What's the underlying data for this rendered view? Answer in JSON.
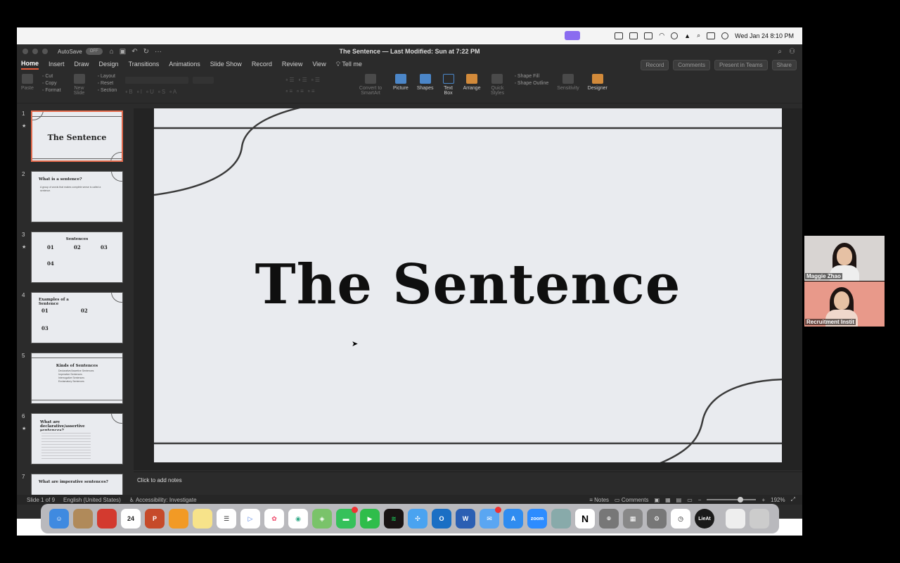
{
  "menubar": {
    "datetime": "Wed Jan 24  8:10 PM",
    "apple_icon": "apple-icon"
  },
  "window": {
    "autosave_label": "AutoSave",
    "autosave_state": "OFF",
    "title": "The Sentence — Last Modified: Sun at 7:22 PM"
  },
  "tabs": [
    "Home",
    "Insert",
    "Draw",
    "Design",
    "Transitions",
    "Animations",
    "Slide Show",
    "Record",
    "Review",
    "View",
    "Tell me"
  ],
  "tab_buttons": {
    "record": "Record",
    "comments": "Comments",
    "present": "Present in Teams",
    "share": "Share"
  },
  "ribbon": {
    "paste": "Paste",
    "cut": "Cut",
    "copy": "Copy",
    "format": "Format",
    "new_slide": "New Slide",
    "layout": "Layout",
    "reset": "Reset",
    "section": "Section",
    "convert_smartart": "Convert to SmartArt",
    "picture": "Picture",
    "shapes": "Shapes",
    "text_box": "Text Box",
    "arrange": "Arrange",
    "quick_styles": "Quick Styles",
    "shape_fill": "Shape Fill",
    "shape_outline": "Shape Outline",
    "sensitivity": "Sensitivity",
    "designer": "Designer"
  },
  "thumbnails": [
    {
      "num": "1",
      "title": "The Sentence"
    },
    {
      "num": "2",
      "title": "What is a sentence?",
      "body": "A group of words that makes complete sense is called a sentence."
    },
    {
      "num": "3",
      "title": "Sentences",
      "n1": "01",
      "n2": "02",
      "n3": "03",
      "n4": "04"
    },
    {
      "num": "4",
      "title": "Examples of a Sentence",
      "n1": "01",
      "n2": "02",
      "n3": "03"
    },
    {
      "num": "5",
      "title": "Kinds of Sentences",
      "items": [
        "Declarative/Assertive Sentences",
        "Imperative Sentences",
        "Interrogative Sentences",
        "Exclamatory Sentences"
      ]
    },
    {
      "num": "6",
      "title": "What are declarative/assertive sentences?"
    },
    {
      "num": "7",
      "title": "What are imperative sentences?"
    }
  ],
  "slide": {
    "title": "The Sentence"
  },
  "notes": {
    "placeholder": "Click to add notes"
  },
  "status": {
    "slide_of": "Slide 1 of 9",
    "language": "English (United States)",
    "accessibility": "Accessibility: Investigate",
    "notes": "Notes",
    "comments": "Comments",
    "zoom": "192%"
  },
  "dock": {
    "calendar_date": "24",
    "zoom_label": "zoom",
    "lieat_label": "LieAt"
  },
  "video": {
    "p1": "Maggie Zhao",
    "p2": "Recruitment Instit"
  }
}
